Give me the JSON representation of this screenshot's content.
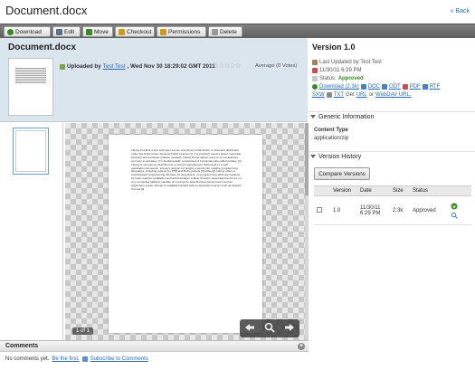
{
  "header": {
    "title": "Document.docx",
    "back_link": "« Back"
  },
  "toolbar": {
    "buttons": [
      {
        "label": "Download",
        "icon": "download-icon",
        "color": "#3a8a22"
      },
      {
        "label": "Edit",
        "icon": "edit-icon",
        "color": "#5a6f88"
      },
      {
        "label": "Move",
        "icon": "move-icon",
        "color": "#3a8a22"
      },
      {
        "label": "Checkout",
        "icon": "lock-icon",
        "color": "#d19a16"
      },
      {
        "label": "Permissions",
        "icon": "key-icon",
        "color": "#d19a16"
      },
      {
        "label": "Delete",
        "icon": "delete-icon",
        "color": "#999999"
      }
    ]
  },
  "document": {
    "title": "Document.docx",
    "uploaded_prefix": "Uploaded by",
    "uploader": "Test Test",
    "uploaded_date": ", Wed Nov 30 18:29:02 GMT 2011",
    "rating": {
      "stars": 5,
      "filled": 0
    },
    "average_votes": "Average (0 Votes)"
  },
  "viewer": {
    "page_text": "Liferay Portal is a free and open source enterprise portal written in Java and distributed under the GNU Lesser General Public License [1]. It is primarily used to power corporate intranets and extranets (citation needed). Liferay Portal allows users to set up features common to websites. It is fundamentally constructed of functional units called portlets. [2] Liferay is sometimes described as a content management framework or a web application framework. Liferay's support for plugins extends into multiple programming languages, including support for PHP and Ruby portlets.[3] Although Liferay offers a sophisticated programming interface for developers, no programming skills are required for basic website installation and administration. Liferay Portal is Java-based and runs on any computing platform capable of running the Java Runtime Environment and an application server. Liferay is available bundled with an application server such as Apache Tomcat.[4]",
    "page_count": "1 of 1"
  },
  "comments": {
    "heading": "Comments",
    "no_comments": "No comments yet.",
    "be_first": "Be the first.",
    "subscribe": "Subscribe to Comments"
  },
  "version": {
    "title": "Version 1.0",
    "last_updated": "Last Updated by Test Test",
    "date": "11/30/11 6:29 PM",
    "status_label": "Status:",
    "status_value": "Approved",
    "download_label": "Download (2.3k)",
    "formats": [
      "DOC",
      "ODT",
      "PDF",
      "RTF",
      "SXW",
      "TXT"
    ],
    "get_label": "Get",
    "url_label": "URL",
    "or_label": "or",
    "webdav_label": "WebDAV URL."
  },
  "generic_info": {
    "heading": "Generic Information",
    "content_type_label": "Content Type",
    "content_type_value": "application/zip"
  },
  "version_history": {
    "heading": "Version History",
    "compare_button": "Compare Versions",
    "columns": [
      "",
      "Version",
      "Date",
      "Size",
      "Status",
      ""
    ],
    "rows": [
      {
        "version": "1.0",
        "date": "11/30/11 6:29 PM",
        "size": "2.3k",
        "status": "Approved"
      }
    ]
  },
  "colors": {
    "toolbar_bg": "#6f6f6f",
    "header_panel_bg": "#dbe5ee",
    "link": "#2a6bb8",
    "approved": "#3a8a22"
  }
}
